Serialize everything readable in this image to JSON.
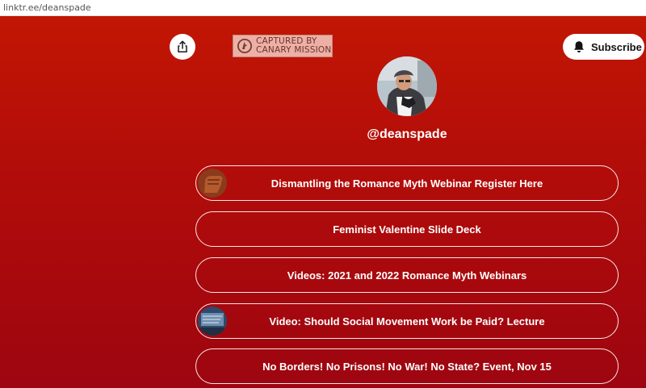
{
  "browser": {
    "url": "linktr.ee/deanspade"
  },
  "toolbar": {
    "share_icon": "share-icon",
    "subscribe_label": "Subscribe",
    "subscribe_icon": "bell-icon"
  },
  "watermark": {
    "line1": "CAPTURED BY",
    "line2": "CANARY MISSION"
  },
  "profile": {
    "handle": "@deanspade"
  },
  "links": [
    {
      "label": "Dismantling the Romance Myth Webinar Register Here",
      "thumbnail": "fist-image"
    },
    {
      "label": "Feminist Valentine Slide Deck"
    },
    {
      "label": "Videos: 2021 and 2022 Romance Myth Webinars"
    },
    {
      "label": "Video: Should Social Movement Work be Paid? Lecture",
      "thumbnail": "protest-image"
    },
    {
      "label": "No Borders! No Prisons! No War! No State? Event, Nov 15"
    }
  ],
  "colors": {
    "background_top": "#c21604",
    "background_bottom": "#9d0510",
    "button_border": "#ffffff"
  }
}
